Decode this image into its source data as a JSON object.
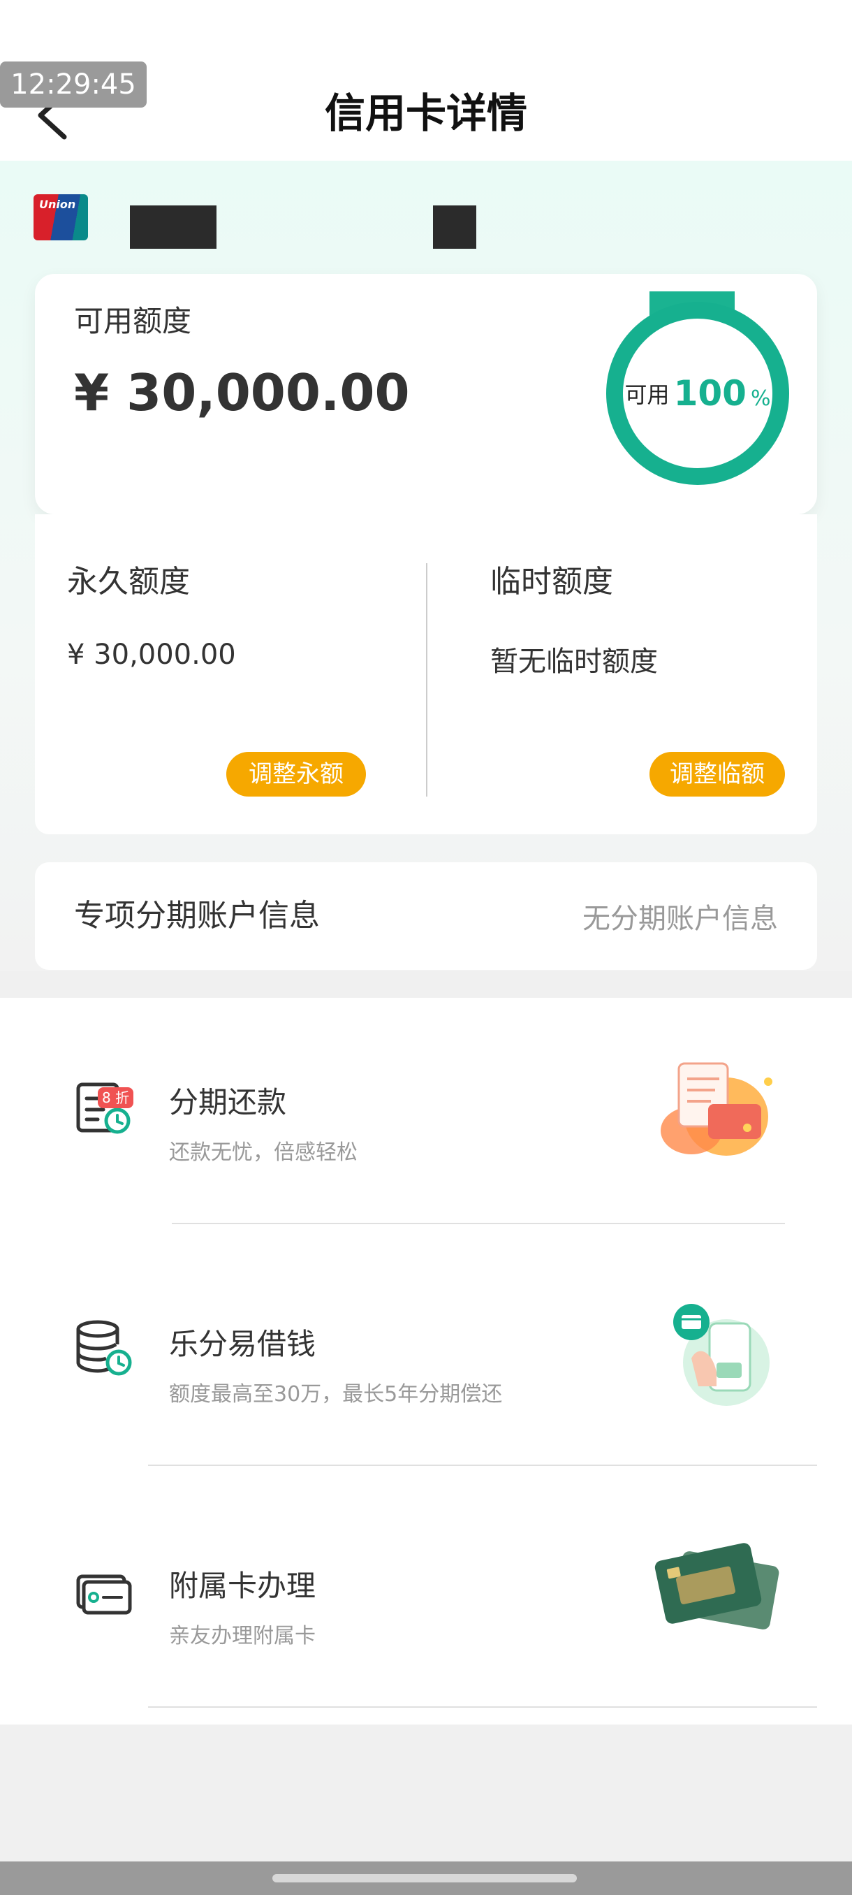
{
  "status": {
    "time": "12:29:45"
  },
  "header": {
    "title": "信用卡详情"
  },
  "available": {
    "label": "可用额度",
    "amount": "¥ 30,000.00",
    "ring_label": "可用",
    "ring_percent": "100",
    "ring_unit": "%",
    "ring_fill_fraction": 1.0
  },
  "permanent": {
    "title": "永久额度",
    "value": "¥ 30,000.00",
    "button": "调整永额"
  },
  "temporary": {
    "title": "临时额度",
    "value": "暂无临时额度",
    "button": "调整临额"
  },
  "installment_account": {
    "label": "专项分期账户信息",
    "value": "无分期账户信息"
  },
  "services": [
    {
      "title": "分期还款",
      "subtitle": "还款无忧，倍感轻松",
      "badge": "8 折"
    },
    {
      "title": "乐分易借钱",
      "subtitle": "额度最高至30万，最长5年分期偿还"
    },
    {
      "title": "附属卡办理",
      "subtitle": "亲友办理附属卡"
    }
  ],
  "colors": {
    "accent": "#16b08f",
    "pill": "#f6a800",
    "badge": "#f05252"
  }
}
